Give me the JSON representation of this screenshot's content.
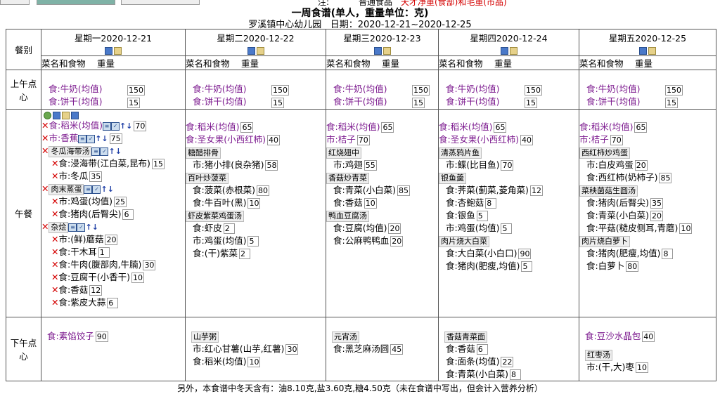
{
  "top": {
    "label_left": "注:",
    "label_mid": "普通食品",
    "notice": "天才净重(食部)和毛重(市品)"
  },
  "title": "一周食谱(单人，重量单位：克)",
  "subtitle": {
    "school": "罗溪镇中心幼儿园",
    "date": "日期：2020-12-21~2020-12-25"
  },
  "meal_header": "餐别",
  "col_header": "菜名和食物　 重量",
  "days": [
    "星期一2020-12-21",
    "星期二2020-12-22",
    "星期三2020-12-23",
    "星期四2020-12-24",
    "星期五2020-12-25"
  ],
  "meals": [
    "上午点心",
    "午餐",
    "下午点心"
  ],
  "am": [
    [
      [
        "食:牛奶(均值)",
        "150"
      ],
      [
        "食:饼干(均值)",
        "15"
      ]
    ],
    [
      [
        "食:牛奶(均值)",
        "150"
      ],
      [
        "食:饼干(均值)",
        "15"
      ]
    ],
    [
      [
        "食:牛奶(均值)",
        "150"
      ],
      [
        "食:饼干(均值)",
        "15"
      ]
    ],
    [
      [
        "食:牛奶(均值)",
        "150"
      ],
      [
        "食:饼干(均值)",
        "15"
      ]
    ],
    [
      [
        "食:牛奶(均值)",
        "150"
      ],
      [
        "食:饼干(均值)",
        "15"
      ]
    ]
  ],
  "lunch": {
    "mon": {
      "rows": [
        {
          "type": "item",
          "x": true,
          "text": "食:稻米(均值)",
          "qty": "70",
          "ctl": true,
          "purple": true
        },
        {
          "type": "item",
          "x": true,
          "text": "市:香蕉",
          "qty": "75",
          "ctl": true,
          "purple": true
        },
        {
          "type": "dish",
          "x": true,
          "text": "冬瓜海带汤",
          "ctl": true
        },
        {
          "type": "item",
          "x": true,
          "sub": true,
          "text": "食:浸海带(江白菜,昆布)",
          "qty": "15"
        },
        {
          "type": "item",
          "x": true,
          "sub": true,
          "text": "市:冬瓜",
          "qty": "35"
        },
        {
          "type": "dish",
          "x": true,
          "text": "肉末蒸蛋",
          "ctl": true
        },
        {
          "type": "item",
          "x": true,
          "sub": true,
          "text": "市:鸡蛋(均值)",
          "qty": "25"
        },
        {
          "type": "item",
          "x": true,
          "sub": true,
          "text": "食:猪肉(后臀尖)",
          "qty": "6"
        },
        {
          "type": "dish",
          "x": true,
          "text": "杂烩",
          "ctl": true
        },
        {
          "type": "item",
          "x": true,
          "sub": true,
          "text": "市:(鲜)蘑菇",
          "qty": "20"
        },
        {
          "type": "item",
          "x": true,
          "sub": true,
          "text": "食:干木耳",
          "qty": "1"
        },
        {
          "type": "item",
          "x": true,
          "sub": true,
          "text": "食:牛肉(腹部肉,牛腩)",
          "qty": "30"
        },
        {
          "type": "item",
          "x": true,
          "sub": true,
          "text": "食:豆腐干(小香干)",
          "qty": "10"
        },
        {
          "type": "item",
          "x": true,
          "sub": true,
          "text": "食:香菇",
          "qty": "12"
        },
        {
          "type": "item",
          "x": true,
          "sub": true,
          "text": "食:紫皮大蒜",
          "qty": "6"
        }
      ]
    },
    "tue": [
      {
        "type": "item",
        "text": "食:稻米(均值)",
        "qty": "65",
        "purple": true
      },
      {
        "type": "item",
        "text": "食:圣女果(小西红柿)",
        "qty": "40",
        "purple": true
      },
      {
        "type": "dish",
        "text": "糖醋排骨"
      },
      {
        "type": "item",
        "sub": true,
        "text": "市:猪小排(良杂猪)",
        "qty": "58"
      },
      {
        "type": "dish",
        "text": "百叶炒菠菜"
      },
      {
        "type": "item",
        "sub": true,
        "text": "食:菠菜(赤根菜)",
        "qty": "80"
      },
      {
        "type": "item",
        "sub": true,
        "text": "食:牛百叶(黑)",
        "qty": "10"
      },
      {
        "type": "dish",
        "text": "虾皮紫菜鸡蛋汤"
      },
      {
        "type": "item",
        "sub": true,
        "text": "食:虾皮",
        "qty": "2"
      },
      {
        "type": "item",
        "sub": true,
        "text": "市:鸡蛋(均值)",
        "qty": "5"
      },
      {
        "type": "item",
        "sub": true,
        "text": "食:(干)紫菜",
        "qty": "2"
      }
    ],
    "wed": [
      {
        "type": "item",
        "text": "食:稻米(均值)",
        "qty": "65",
        "purple": true
      },
      {
        "type": "item",
        "text": "市:桔子",
        "qty": "70",
        "purple": true
      },
      {
        "type": "dish",
        "text": "红烧翅中"
      },
      {
        "type": "item",
        "sub": true,
        "text": "市:鸡翅",
        "qty": "55"
      },
      {
        "type": "dish",
        "text": "香菇炒青菜"
      },
      {
        "type": "item",
        "sub": true,
        "text": "食:青菜(小白菜)",
        "qty": "85"
      },
      {
        "type": "item",
        "sub": true,
        "text": "食:香菇",
        "qty": "10"
      },
      {
        "type": "dish",
        "text": "鸭血豆腐汤"
      },
      {
        "type": "item",
        "sub": true,
        "text": "食:豆腐(均值)",
        "qty": "20"
      },
      {
        "type": "item",
        "sub": true,
        "text": "食:公麻鸭鸭血",
        "qty": "20"
      }
    ],
    "thu": [
      {
        "type": "item",
        "text": "食:稻米(均值)",
        "qty": "65",
        "purple": true
      },
      {
        "type": "item",
        "text": "食:圣女果(小西红柿)",
        "qty": "40",
        "purple": true
      },
      {
        "type": "dish",
        "text": "清蒸鸦片鱼"
      },
      {
        "type": "item",
        "sub": true,
        "text": "市:鲽(比目鱼)",
        "qty": "70"
      },
      {
        "type": "dish",
        "text": "银鱼羹"
      },
      {
        "type": "item",
        "sub": true,
        "text": "食:荠菜(蓟菜,菱角菜)",
        "qty": "12"
      },
      {
        "type": "item",
        "sub": true,
        "text": "食:杏鲍菇",
        "qty": "8"
      },
      {
        "type": "item",
        "sub": true,
        "text": "食:银鱼",
        "qty": "5"
      },
      {
        "type": "item",
        "sub": true,
        "text": "市:鸡蛋(均值)",
        "qty": "5"
      },
      {
        "type": "dish",
        "text": "肉片烧大白菜"
      },
      {
        "type": "item",
        "sub": true,
        "text": "食:大白菜(小白口)",
        "qty": "90"
      },
      {
        "type": "item",
        "sub": true,
        "text": "食:猪肉(肥瘦,均值)",
        "qty": "5"
      }
    ],
    "fri": [
      {
        "type": "item",
        "text": "食:稻米(均值)",
        "qty": "65",
        "purple": true
      },
      {
        "type": "item",
        "text": "市:桔子",
        "qty": "70",
        "purple": true
      },
      {
        "type": "dish",
        "text": "西红柿炒鸡蛋"
      },
      {
        "type": "item",
        "sub": true,
        "text": "市:白皮鸡蛋",
        "qty": "20"
      },
      {
        "type": "item",
        "sub": true,
        "text": "食:西红柿(奶柿子)",
        "qty": "85"
      },
      {
        "type": "dish",
        "text": "菜秧菌菇生圆汤"
      },
      {
        "type": "item",
        "sub": true,
        "text": "食:猪肉(后臀尖)",
        "qty": "35"
      },
      {
        "type": "item",
        "sub": true,
        "text": "食:青菜(小白菜)",
        "qty": "20"
      },
      {
        "type": "item",
        "sub": true,
        "text": "食:平菇(糙皮侧耳,青蘑)",
        "qty": "10"
      },
      {
        "type": "dish",
        "text": "肉片烧白萝卜"
      },
      {
        "type": "item",
        "sub": true,
        "text": "食:猪肉(肥瘦,均值)",
        "qty": "8"
      },
      {
        "type": "item",
        "sub": true,
        "text": "食:白萝卜",
        "qty": "80"
      }
    ]
  },
  "pm": [
    [
      {
        "type": "item",
        "text": "食:素馅饺子",
        "qty": "90",
        "purple": true,
        "gap": true
      }
    ],
    [
      {
        "type": "dish",
        "text": "山芋粥"
      },
      {
        "type": "item",
        "sub": true,
        "text": "市:红心甘薯(山芋,红薯)",
        "qty": "30"
      },
      {
        "type": "item",
        "sub": true,
        "text": "食:稻米(均值)",
        "qty": "10"
      }
    ],
    [
      {
        "type": "dish",
        "text": "元宵汤"
      },
      {
        "type": "item",
        "sub": true,
        "text": "食:黑芝麻汤圆",
        "qty": "45"
      }
    ],
    [
      {
        "type": "dish",
        "text": "香菇青菜面"
      },
      {
        "type": "item",
        "sub": true,
        "text": "食:香菇",
        "qty": "6"
      },
      {
        "type": "item",
        "sub": true,
        "text": "食:面条(均值)",
        "qty": "22"
      },
      {
        "type": "item",
        "sub": true,
        "text": "食:青菜(小白菜)",
        "qty": "8"
      }
    ],
    [
      {
        "type": "item",
        "text": "食:豆沙水晶包",
        "qty": "40",
        "purple": true,
        "gap": true
      },
      {
        "type": "dish",
        "text": "红枣汤"
      },
      {
        "type": "item",
        "sub": true,
        "text": "市:(干,大)枣",
        "qty": "10"
      }
    ]
  ],
  "footer": "另外，本食谱中冬天含有：油8.10克,盐3.60克,糖4.50克（未在食谱中写出，但会计入营养分析）"
}
